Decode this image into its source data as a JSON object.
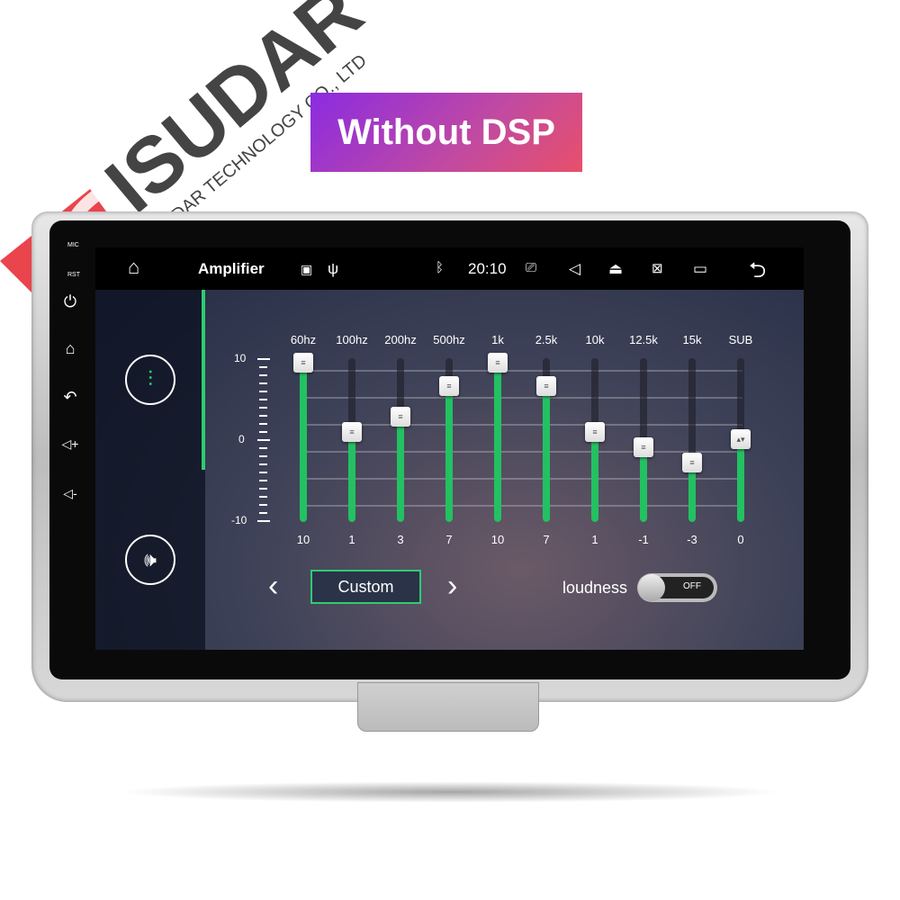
{
  "brand": {
    "name": "ISUDAR",
    "company": "ISUDAR TECHNOLOGY CO., LTD",
    "logo_color": "#e8303a"
  },
  "banner": {
    "text": "Without DSP"
  },
  "bezel": {
    "mic_label": "MIC",
    "rst_label": "RST"
  },
  "status_bar": {
    "title": "Amplifier",
    "time": "20:10",
    "icons": [
      "home-icon",
      "image-icon",
      "usb-icon",
      "bluetooth-icon",
      "camera-icon",
      "volume-icon",
      "eject-icon",
      "screen-off-icon",
      "recent-apps-icon",
      "back-icon"
    ]
  },
  "side_icons": [
    "power-icon",
    "home-icon",
    "back-icon",
    "volume-up-icon",
    "volume-down-icon"
  ],
  "equalizer": {
    "scale": {
      "max": "10",
      "mid": "0",
      "min": "-10"
    },
    "accent": "#23c162",
    "bands": [
      {
        "label": "60hz",
        "value": 10
      },
      {
        "label": "100hz",
        "value": 1
      },
      {
        "label": "200hz",
        "value": 3
      },
      {
        "label": "500hz",
        "value": 7
      },
      {
        "label": "1k",
        "value": 10
      },
      {
        "label": "2.5k",
        "value": 7
      },
      {
        "label": "10k",
        "value": 1
      },
      {
        "label": "12.5k",
        "value": -1
      },
      {
        "label": "15k",
        "value": -3
      },
      {
        "label": "SUB",
        "value": 0
      }
    ],
    "value_labels": [
      "10",
      "1",
      "3",
      "7",
      "10",
      "7",
      "1",
      "-1",
      "-3",
      "0"
    ]
  },
  "preset": {
    "label": "Custom",
    "prev": "‹",
    "next": "›"
  },
  "loudness": {
    "label": "loudness",
    "state": "OFF"
  }
}
